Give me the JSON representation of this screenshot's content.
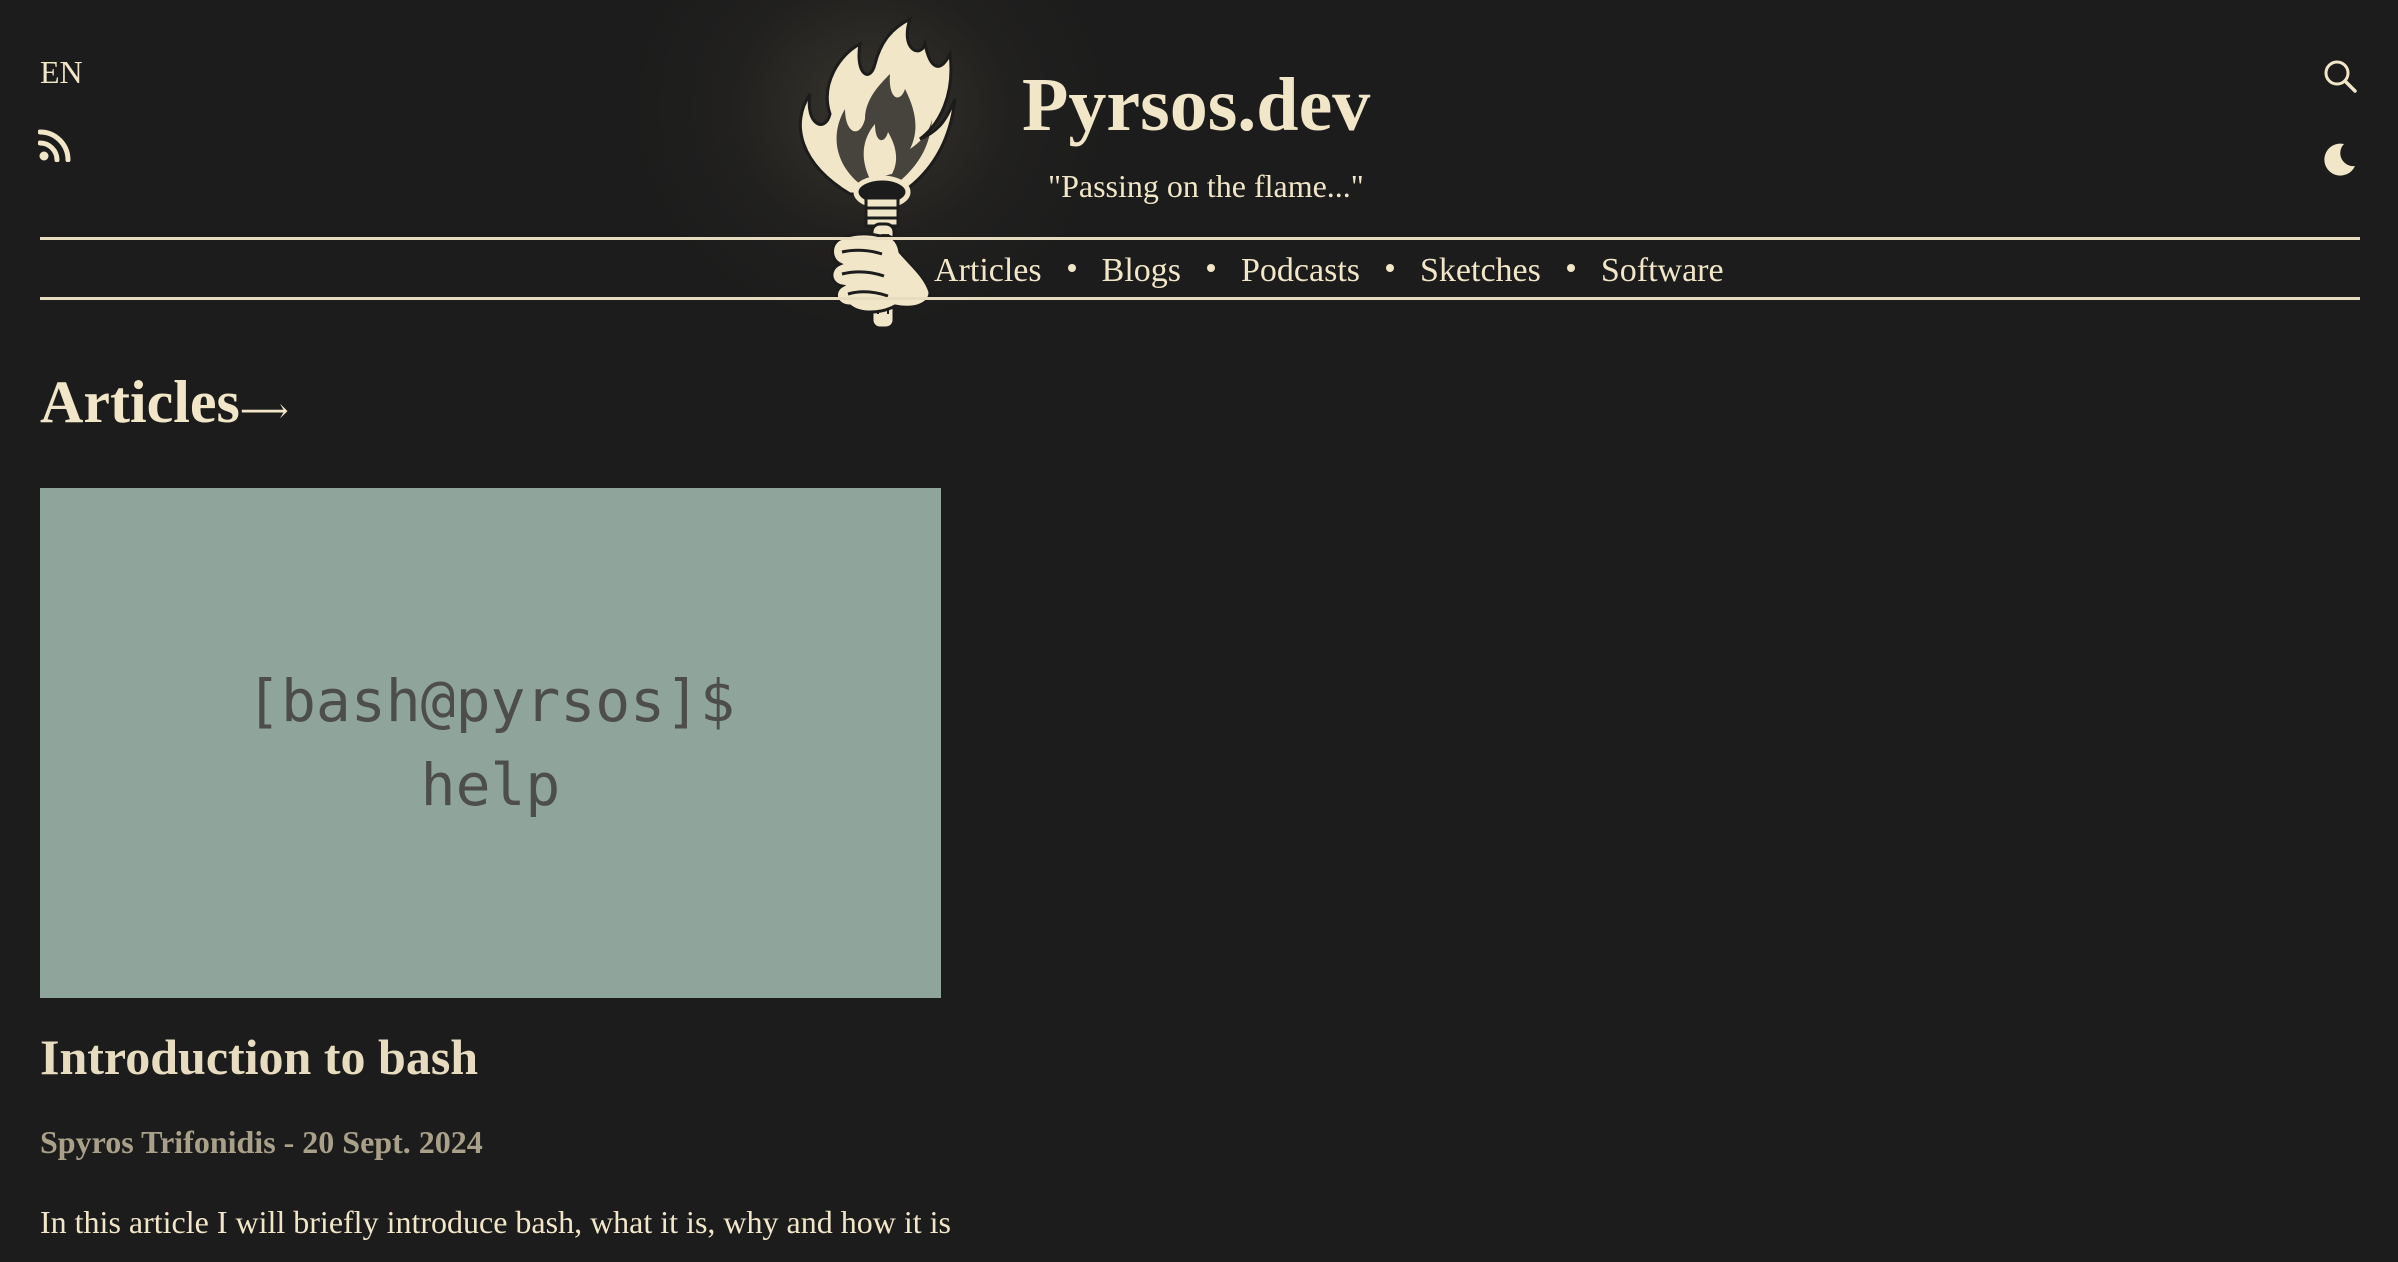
{
  "header": {
    "language": "EN",
    "site_title": "Pyrsos.dev",
    "tagline": "\"Passing on the flame...\"",
    "icons": {
      "rss": "rss-icon",
      "search": "search-icon",
      "theme": "moon-icon",
      "logo": "torch-logo-icon"
    }
  },
  "nav": {
    "items": [
      {
        "label": "Articles"
      },
      {
        "label": "Blogs"
      },
      {
        "label": "Podcasts"
      },
      {
        "label": "Sketches"
      },
      {
        "label": "Software"
      }
    ]
  },
  "main": {
    "section_title": "Articles",
    "section_arrow": "⟶",
    "articles": [
      {
        "image_text_line1": "[bash@pyrsos]$",
        "image_text_line2": "help",
        "title": "Introduction to bash",
        "meta": "Spyros Trifonidis - 20 Sept. 2024",
        "excerpt": "In this article I will briefly introduce bash, what it is, why and how it is"
      }
    ]
  },
  "colors": {
    "background": "#1c1c1c",
    "text": "#f2e6c9",
    "meta": "#a9a08a",
    "card_image_bg": "#8fa59b",
    "card_image_text": "#4d4d4b"
  }
}
